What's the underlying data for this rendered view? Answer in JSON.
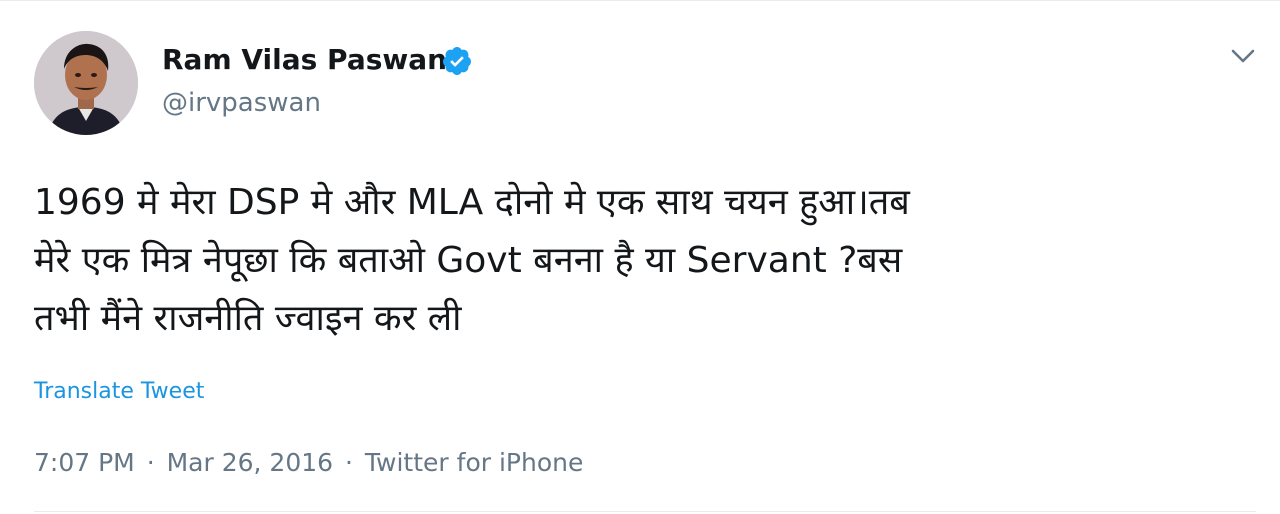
{
  "author": {
    "display_name": "Ram Vilas Paswan",
    "handle": "@irvpaswan",
    "verified": true
  },
  "tweet": {
    "lines": [
      "1969 मे मेरा DSP मे और MLA दोनो मे एक साथ चयन हुआ।तब",
      "मेरे एक मित्र नेपूछा कि बताओ Govt बनना है या Servant ?बस",
      "तभी मैंने राजनीति ज्वाइन कर ली"
    ],
    "translate_label": "Translate Tweet"
  },
  "meta": {
    "time": "7:07 PM",
    "separator": "·",
    "date": "Mar 26, 2016",
    "source": "Twitter for iPhone"
  },
  "icons": {
    "verified": "verified-badge-icon",
    "menu": "chevron-down-icon"
  },
  "colors": {
    "link": "#1b95e0",
    "secondary_text": "#657786",
    "primary_text": "#14171a",
    "verified": "#1da1f2"
  }
}
